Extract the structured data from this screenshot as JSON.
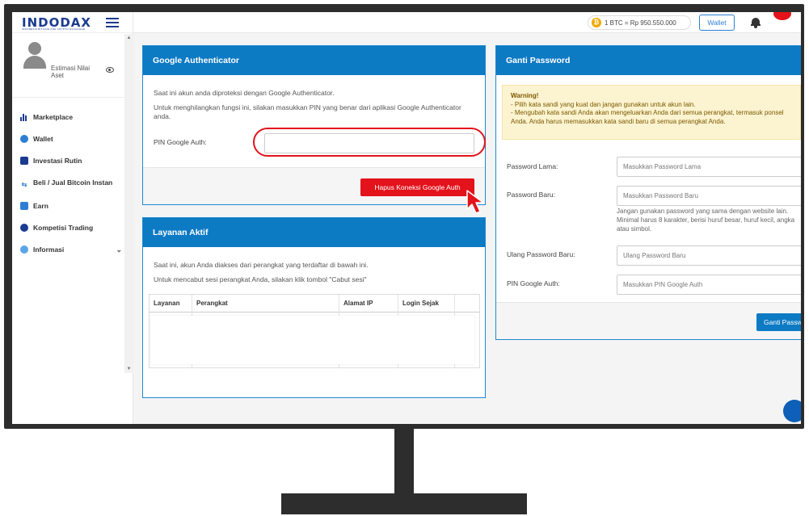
{
  "app": {
    "logo_text": "INDODAX",
    "logo_tagline": "INDONESIA BITCOIN AND CRYPTO EXCHANGE"
  },
  "header": {
    "btc_price": "1 BTC = Rp  950.550.000",
    "wallet_label": "Wallet"
  },
  "sidebar": {
    "estimate_label": "Estimasi Nilai Aset",
    "items": [
      {
        "label": "Marketplace",
        "icon": "chart-bar-icon"
      },
      {
        "label": "Wallet",
        "icon": "wallet-icon"
      },
      {
        "label": "Investasi Rutin",
        "icon": "calendar-icon"
      },
      {
        "label": "Beli / Jual Bitcoin Instan",
        "icon": "exchange-icon"
      },
      {
        "label": "Earn",
        "icon": "earn-icon"
      },
      {
        "label": "Kompetisi Trading",
        "icon": "trophy-icon"
      },
      {
        "label": "Informasi",
        "icon": "info-icon"
      }
    ]
  },
  "google_auth": {
    "title": "Google Authenticator",
    "text1": "Saat ini akun anda diproteksi dengan Google Authenticator.",
    "text2": "Untuk menghilangkan fungsi ini, silakan masukkan PIN yang benar dari aplikasi Google Authenticator anda.",
    "pin_label": "PIN Google Auth:",
    "pin_value": "",
    "button_label": "Hapus Koneksi Google Auth"
  },
  "active_services": {
    "title": "Layanan Aktif",
    "text1": "Saat ini, akun Anda diakses dari perangkat yang terdaftar di bawah ini.",
    "text2": "Untuk mencabut sesi perangkat Anda, silakan klik tombol \"Cabut sesi\"",
    "columns": [
      "Layanan",
      "Perangkat",
      "Alamat IP",
      "Login Sejak"
    ]
  },
  "change_password": {
    "title": "Ganti Password",
    "warning_title": "Warning!",
    "warning_line1": "- Pilih kata sandi yang kuat dan jangan gunakan untuk akun lain.",
    "warning_line2": "- Mengubah kata sandi Anda akan mengeluarkan Anda dari semua perangkat, termasuk ponsel Anda. Anda harus memasukkan kata sandi baru di semua perangkat Anda.",
    "old_label": "Password Lama:",
    "old_placeholder": "Masukkan Password Lama",
    "new_label": "Password Baru:",
    "new_placeholder": "Masukkan Password Baru",
    "help_line1": "Jangan gunakan password yang sama dengan website lain.",
    "help_line2": "Minimal harus 8 karakter, berisi huruf besar, huruf kecil, angka atau simbol.",
    "repeat_label": "Ulang Password Baru:",
    "repeat_placeholder": "Ulang Password Baru",
    "pin_label": "PIN Google Auth:",
    "pin_placeholder": "Masukkan PIN Google Auth",
    "button_label": "Ganti Password"
  },
  "colors": {
    "primary": "#0d7ac4",
    "danger": "#e3121b",
    "brand": "#1a3b8f",
    "warning_bg": "#fcf3d0"
  }
}
